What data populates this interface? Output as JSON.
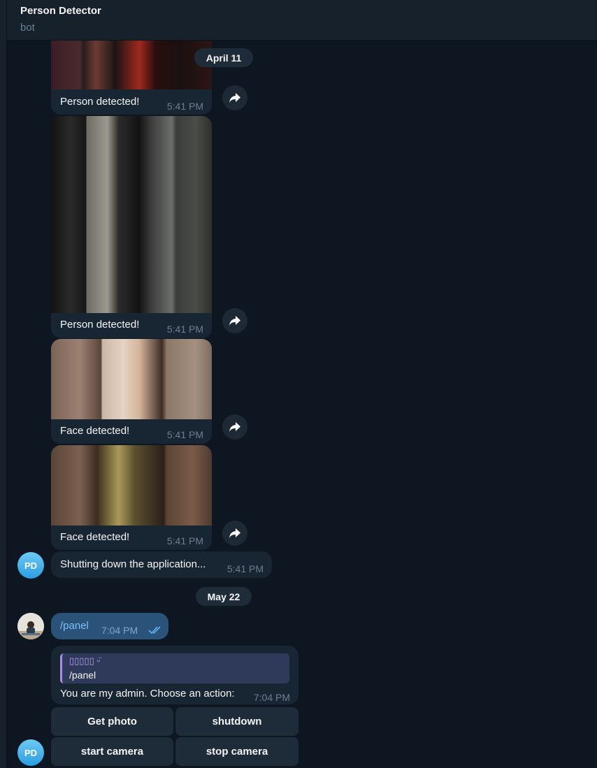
{
  "header": {
    "title": "Person Detector",
    "subtitle": "bot"
  },
  "dates": {
    "first": "April 11",
    "second": "May 22"
  },
  "messages": {
    "photo1": {
      "caption": "Person detected!",
      "time": "5:41 PM"
    },
    "photo2": {
      "caption": "Person detected!",
      "time": "5:41 PM"
    },
    "photo3": {
      "caption": "Face detected!",
      "time": "5:41 PM"
    },
    "photo4": {
      "caption": "Face detected!",
      "time": "5:41 PM"
    },
    "shutdown": {
      "text": "Shutting down the application...",
      "time": "5:41 PM"
    },
    "panel": {
      "text": "/panel",
      "time": "7:04 PM"
    },
    "admin": {
      "reply_name": "▯▯▯▯▯ ᵕ̈",
      "reply_text": "/panel",
      "text": "You are my admin. Choose an action:",
      "time": "7:04 PM"
    }
  },
  "avatars": {
    "bot_initials": "PD"
  },
  "keyboard": {
    "get_photo": "Get photo",
    "shutdown": "shutdown",
    "start_camera": "start camera",
    "stop_camera": "stop camera"
  },
  "icons": {
    "share": "share-icon",
    "read": "double-check-icon"
  },
  "colors": {
    "background": "#0e1621",
    "incoming": "#182533",
    "outgoing": "#2b5278",
    "accent": "#5eb5f7"
  }
}
